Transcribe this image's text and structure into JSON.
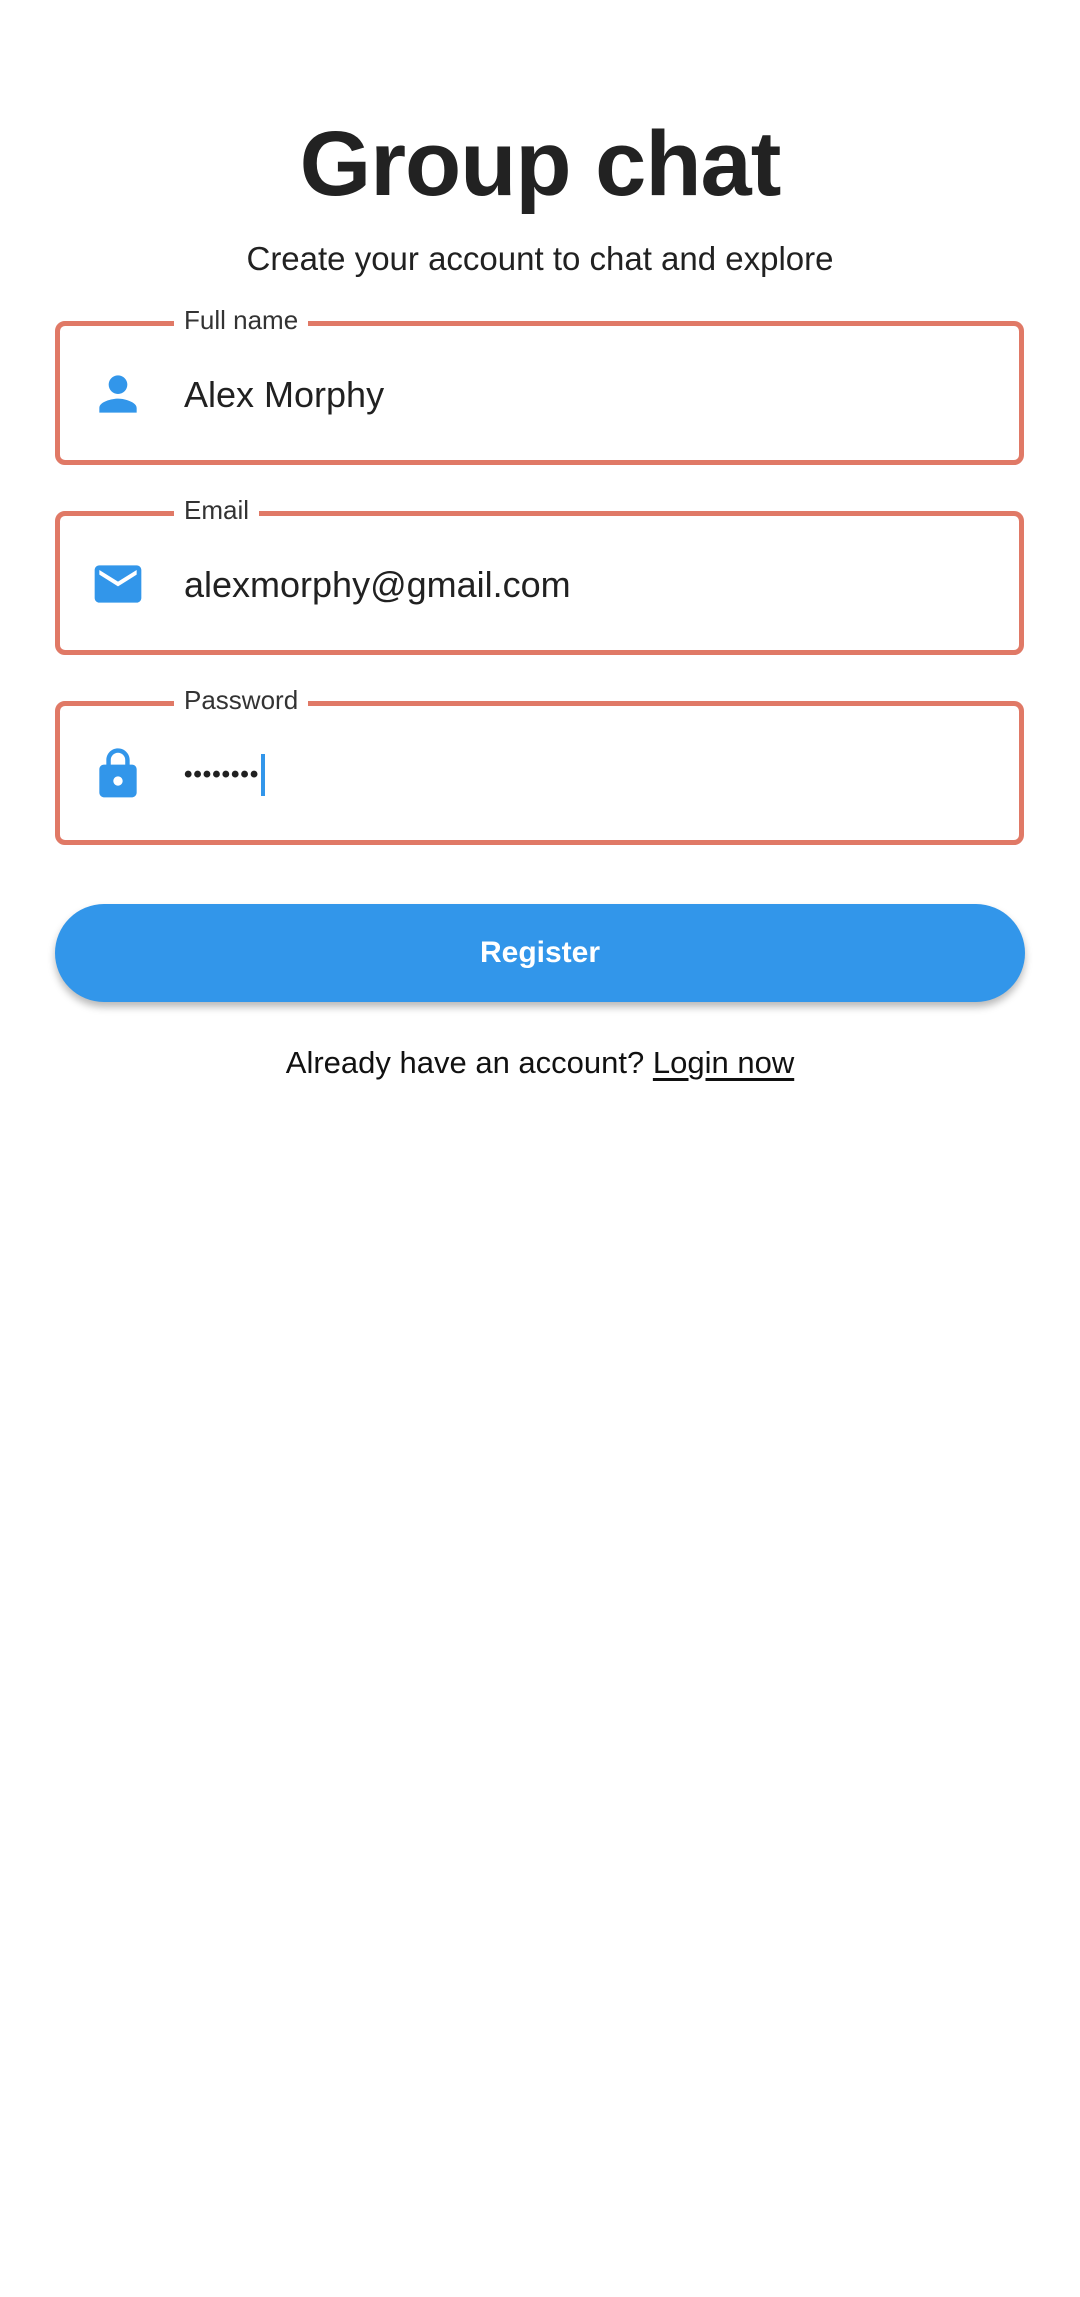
{
  "header": {
    "title": "Group chat",
    "subtitle": "Create your account to chat and explore"
  },
  "form": {
    "full_name": {
      "label": "Full name",
      "value": "Alex Morphy",
      "icon": "person-icon"
    },
    "email": {
      "label": "Email",
      "value": "alexmorphy@gmail.com",
      "icon": "mail-icon"
    },
    "password": {
      "label": "Password",
      "masked_value": "••••••••",
      "icon": "lock-icon"
    },
    "register_label": "Register"
  },
  "footer": {
    "prompt": "Already have an account?",
    "login_link": "Login now"
  },
  "colors": {
    "accent": "#3296ea",
    "field_border": "#e07966",
    "title": "#222222"
  }
}
